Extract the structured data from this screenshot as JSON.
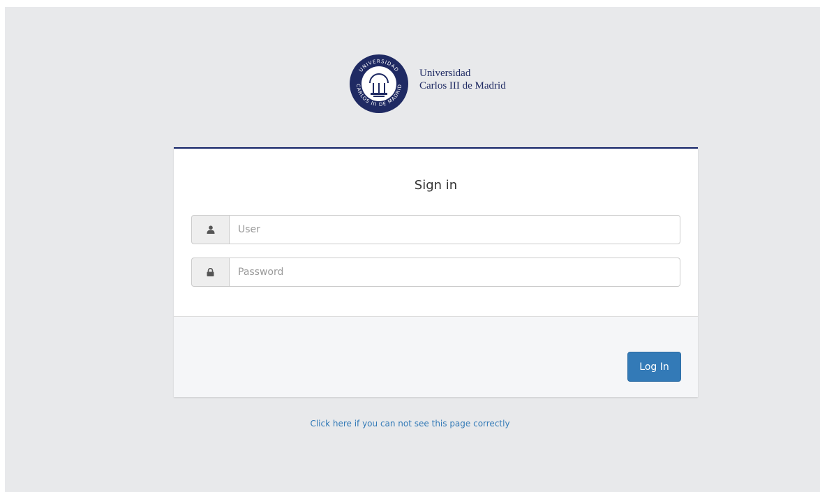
{
  "branding": {
    "university_line1": "Universidad",
    "university_line2": "Carlos III de Madrid",
    "seal_text_top": "UNIVERSIDAD",
    "seal_text_bottom": "CARLOS III DE MADRID"
  },
  "login": {
    "title": "Sign in",
    "user_placeholder": "User",
    "password_placeholder": "Password",
    "user_icon": "user-icon",
    "password_icon": "lock-icon",
    "submit_label": "Log In"
  },
  "footer": {
    "help_link": "Click here if you can not see this page correctly"
  },
  "colors": {
    "brand": "#132367",
    "button": "#337ab7",
    "link": "#337ab7",
    "background": "#e8e9eb"
  }
}
